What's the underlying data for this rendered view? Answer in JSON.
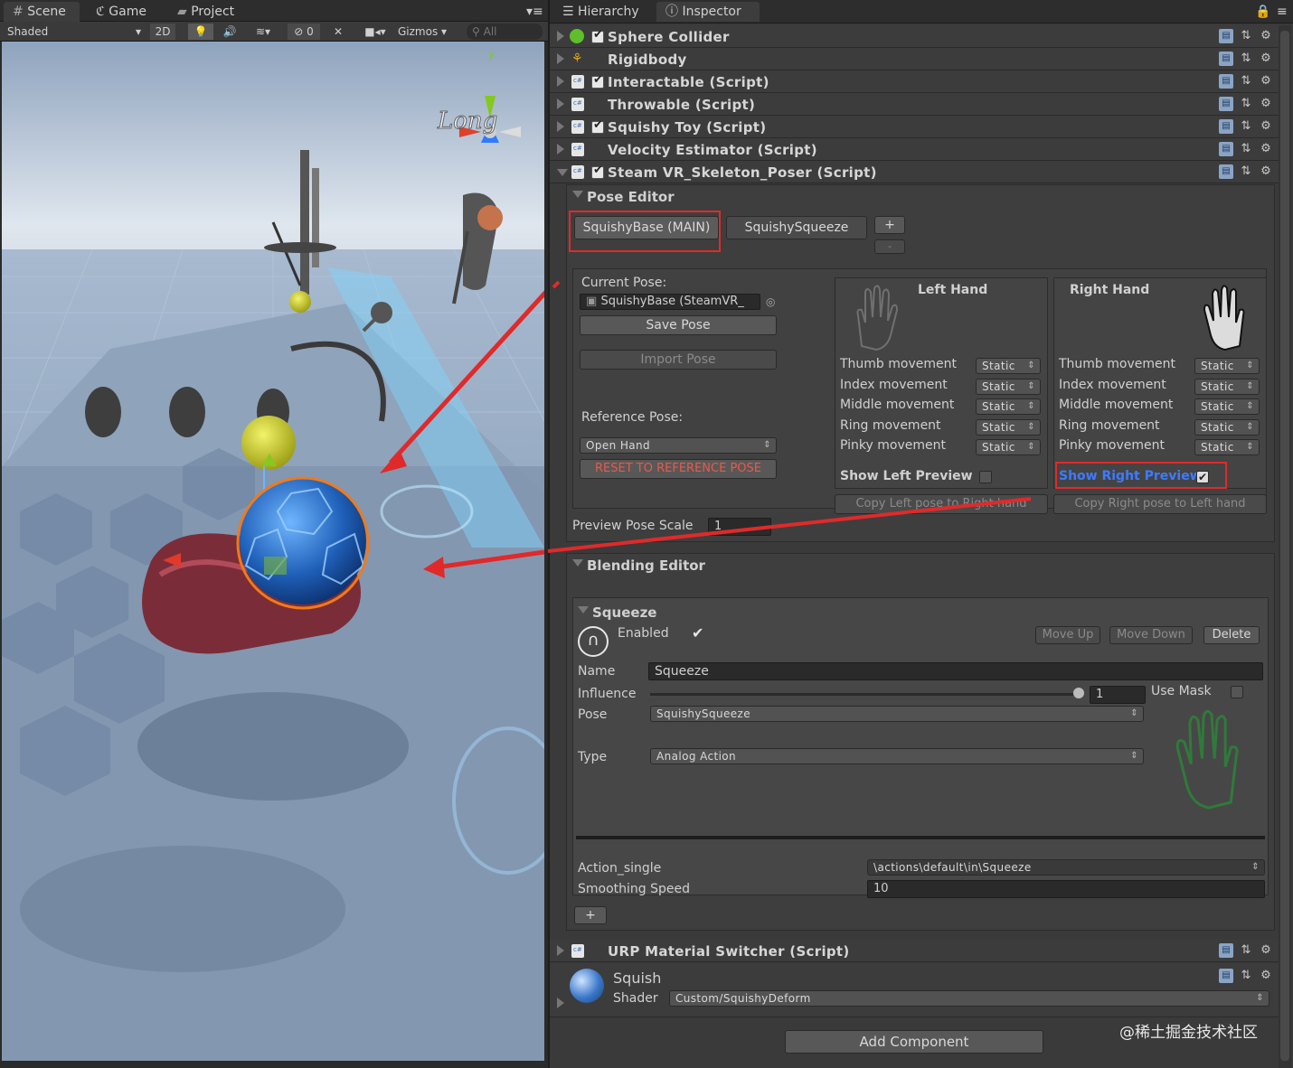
{
  "scene_panel": {
    "tabs": [
      "Scene",
      "Game",
      "Project"
    ],
    "toolbar": {
      "shading": "Shaded",
      "mode_2d": "2D",
      "hidden_count": "0",
      "gizmos": "Gizmos",
      "search_placeholder": "All"
    },
    "gizmo_axes": {
      "y": "y"
    },
    "camera_label": "Long"
  },
  "inspector": {
    "tabs": [
      "Hierarchy",
      "Inspector"
    ],
    "components": [
      {
        "name": "Sphere Collider",
        "checked": true
      },
      {
        "name": "Rigidbody",
        "checked": false
      },
      {
        "name": "Interactable (Script)",
        "checked": true
      },
      {
        "name": "Throwable (Script)",
        "checked": false
      },
      {
        "name": "Squishy Toy (Script)",
        "checked": true
      },
      {
        "name": "Velocity Estimator (Script)",
        "checked": false
      },
      {
        "name": "Steam VR_Skeleton_Poser (Script)",
        "checked": true
      }
    ],
    "pose_editor": {
      "header": "Pose Editor",
      "tabs": [
        "SquishyBase (MAIN)",
        "SquishySqueeze"
      ],
      "add_button": "+",
      "remove_button": "-",
      "current_pose_label": "Current Pose:",
      "current_pose_value": "SquishyBase (SteamVR_",
      "save_pose": "Save Pose",
      "import_pose": "Import Pose",
      "reference_pose_label": "Reference Pose:",
      "reference_pose_value": "Open Hand",
      "reset_button": "RESET TO REFERENCE POSE",
      "left_hand": {
        "title": "Left Hand",
        "rows": [
          {
            "label": "Thumb movement",
            "value": "Static"
          },
          {
            "label": "Index movement",
            "value": "Static"
          },
          {
            "label": "Middle movement",
            "value": "Static"
          },
          {
            "label": "Ring movement",
            "value": "Static"
          },
          {
            "label": "Pinky movement",
            "value": "Static"
          }
        ],
        "preview_label": "Show Left Preview",
        "copy_button": "Copy Left pose to Right hand"
      },
      "right_hand": {
        "title": "Right Hand",
        "rows": [
          {
            "label": "Thumb movement",
            "value": "Static"
          },
          {
            "label": "Index movement",
            "value": "Static"
          },
          {
            "label": "Middle movement",
            "value": "Static"
          },
          {
            "label": "Ring movement",
            "value": "Static"
          },
          {
            "label": "Pinky movement",
            "value": "Static"
          }
        ],
        "preview_label": "Show Right Preview",
        "copy_button": "Copy Right pose to Left hand"
      },
      "preview_scale_label": "Preview Pose Scale",
      "preview_scale_value": "1"
    },
    "blending_editor": {
      "header": "Blending Editor",
      "blend": {
        "title": "Squeeze",
        "enabled_label": "Enabled",
        "move_up": "Move Up",
        "move_down": "Move Down",
        "delete": "Delete",
        "name_label": "Name",
        "name_value": "Squeeze",
        "influence_label": "Influence",
        "influence_value": "1",
        "use_mask_label": "Use Mask",
        "pose_label": "Pose",
        "pose_value": "SquishySqueeze",
        "type_label": "Type",
        "type_value": "Analog Action",
        "action_label": "Action_single",
        "action_value": "\\actions\\default\\in\\Squeeze",
        "smoothing_label": "Smoothing Speed",
        "smoothing_value": "10"
      },
      "add_blend": "+"
    },
    "urp_component": {
      "name": "URP Material Switcher (Script)"
    },
    "material": {
      "name": "Squish",
      "shader_label": "Shader",
      "shader_value": "Custom/SquishyDeform"
    },
    "add_component": "Add Component"
  },
  "watermark": "@稀土掘金技术社区",
  "colors": {
    "annotation_red": "#e02a2a",
    "highlight_blue": "#3d7bff"
  }
}
